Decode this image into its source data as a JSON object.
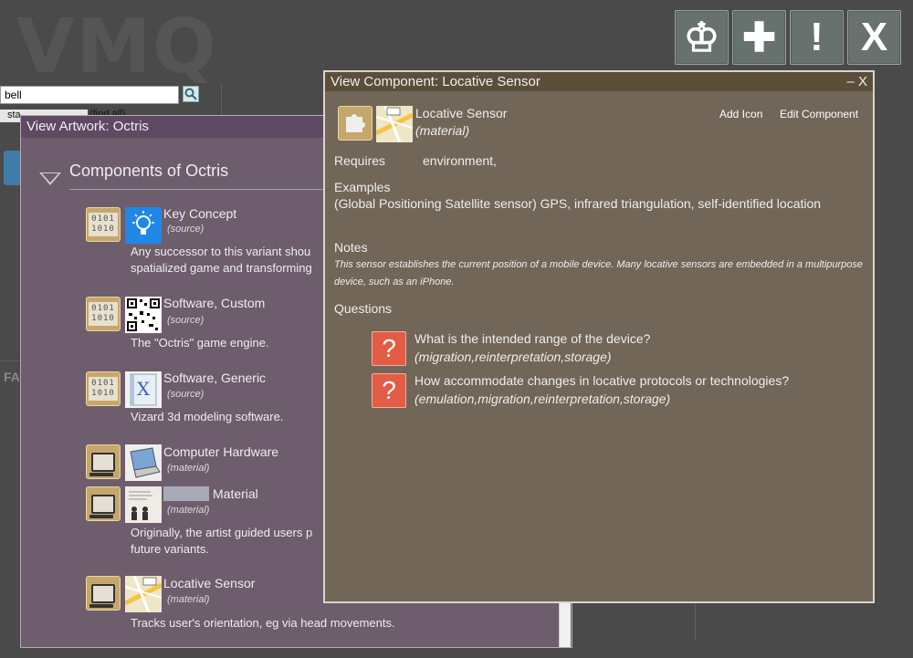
{
  "app": {
    "logo": "VMQ"
  },
  "toolbar": {
    "buttons": [
      {
        "name": "king",
        "glyph": "♔"
      },
      {
        "name": "add",
        "glyph": "✚"
      },
      {
        "name": "alert",
        "glyph": "!"
      },
      {
        "name": "close",
        "glyph": "X"
      }
    ]
  },
  "search": {
    "value": "bell",
    "status_prefix": "sta",
    "find_all": "(find all)"
  },
  "sidebar": {
    "fa_label": "FA"
  },
  "artwork_window": {
    "title": "View Artwork: Octris",
    "heading": "Components of Octris",
    "items": [
      {
        "name": "Key Concept",
        "type": "(source)",
        "desc": "Any successor to this variant shou",
        "desc2": "spatialized game and transforming"
      },
      {
        "name": "Software, Custom",
        "type": "(source)",
        "desc": "The \"Octris\" game engine."
      },
      {
        "name": "Software, Generic",
        "type": "(source)",
        "desc": "Vizard 3d modeling software."
      },
      {
        "name": "Computer Hardware",
        "type": "(material)"
      },
      {
        "name": "Material",
        "type": "(material)",
        "desc": "Originally, the artist guided users p",
        "desc2": "future variants."
      },
      {
        "name": "Locative Sensor",
        "type": "(material)",
        "desc": "Tracks user's orientation, eg via head movements."
      }
    ]
  },
  "component_window": {
    "title": "View Component: Locative Sensor",
    "controls": "– X",
    "name": "Locative Sensor",
    "type": "(material)",
    "add_icon": "Add Icon",
    "edit_component": "Edit Component",
    "requires_label": "Requires",
    "requires_value": "environment,",
    "examples_label": "Examples",
    "examples_text": "(Global Positioning Satellite sensor) GPS, infrared triangulation, self-identified location",
    "notes_label": "Notes",
    "notes_text": "This sensor establishes the current position of a mobile device. Many locative sensors are embedded in a multipurpose device, such as an iPhone.",
    "questions_label": "Questions",
    "questions": [
      {
        "text": "What is the intended range of the device?",
        "tags": "(migration,reinterpretation,storage)"
      },
      {
        "text": "How accommodate changes in locative protocols or technologies?",
        "tags": "(emulation,migration,reinterpretation,storage)"
      }
    ]
  },
  "colors": {
    "artwork_bg": "#6e5d6c",
    "artwork_title": "#5e4a63",
    "component_bg": "#726658",
    "component_title": "#5c4f3a",
    "question_icon": "#e35c45",
    "type_icon": "#c6a76b"
  }
}
